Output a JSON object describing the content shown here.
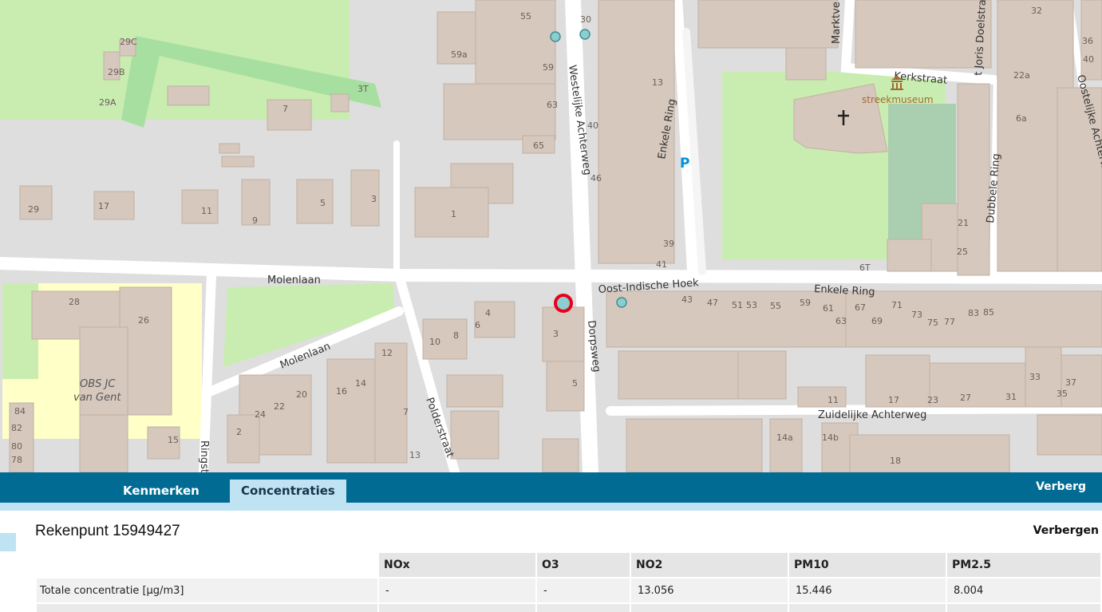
{
  "map": {
    "streets": {
      "molenlaan": "Molenlaan",
      "westelijke_achterweg": "Westelijke Achterweg",
      "dorpsweg": "Dorpsweg",
      "oost_indische_hoek": "Oost-Indische Hoek",
      "enkele_ring_vertical": "Enkele Ring",
      "enkele_ring": "Enkele Ring",
      "zuidelijke_achterweg": "Zuidelijke Achterweg",
      "polderstraat": "Polderstraat",
      "kerkstraat": "Kerkstraat",
      "dubbele_ring": "Dubbele Ring",
      "oostelijke_achterweg": "Oostelijke Achterweg",
      "sint_joris_doelstraat": "t Joris Doelstraat",
      "marktveld": "Marktve",
      "ringstraat": "Ringst"
    },
    "poi": {
      "museum": "streekmuseum",
      "school_line1": "OBS JC",
      "school_line2": "van Gent",
      "parking": "P"
    },
    "colors": {
      "building": "#d6c8bd",
      "park": "#c9edb0",
      "cemetery": "#aacfb0",
      "meadow": "#a7dfa0",
      "road": "#ffffff",
      "school_area": "#ffffc8",
      "marker": "#e8001c"
    },
    "house_numbers": {
      "n55": "55",
      "n59a": "59a",
      "n59": "59",
      "n63": "63",
      "n65": "65",
      "n1a": "1",
      "n30": "30",
      "n40": "40",
      "n46": "46",
      "n29c": "29C",
      "n29b": "29B",
      "n29a": "29A",
      "n7": "7",
      "n3t": "3T",
      "n29": "29",
      "n17": "17",
      "n11": "11",
      "n9": "9",
      "n5": "5",
      "n3": "3",
      "n28": "28",
      "n26": "26",
      "n84": "84",
      "n82": "82",
      "n80": "80",
      "n78": "78",
      "n15": "15",
      "n4": "4",
      "n6": "6",
      "n10": "10",
      "n8": "8",
      "n3b": "3",
      "n5b": "5",
      "n12": "12",
      "n16": "16",
      "n14": "14",
      "n20": "20",
      "n22": "22",
      "n24": "24",
      "n2": "2",
      "n7b": "7",
      "n13": "13",
      "n43": "43",
      "n47": "47",
      "n51": "51",
      "n53": "53",
      "n55b": "55",
      "n59b": "59",
      "n61": "61",
      "n63b": "63",
      "n67": "67",
      "n69": "69",
      "n71": "71",
      "n73": "73",
      "n75": "75",
      "n77": "77",
      "n83": "83",
      "n85": "85",
      "n33": "33",
      "n37": "37",
      "n35": "35",
      "n23": "23",
      "n27": "27",
      "n31": "31",
      "n17b": "17",
      "n11b": "11",
      "n14a": "14a",
      "n14b": "14b",
      "n18": "18",
      "n6t": "6T",
      "n25": "25",
      "n21": "21",
      "n41": "41",
      "n39": "39",
      "n13b": "13",
      "n32": "32",
      "n36": "36",
      "n40b": "40",
      "n22a": "22a",
      "n6a": "6a"
    }
  },
  "tabs": {
    "kenmerken": "Kenmerken",
    "concentraties": "Concentraties",
    "verberg": "Verberg"
  },
  "panel": {
    "title": "Rekenpunt 15949427",
    "hide_label": "Verbergen",
    "table": {
      "headers": [
        "NOx",
        "O3",
        "NO2",
        "PM10",
        "PM2.5"
      ],
      "rows": [
        {
          "label": "Totale concentratie [µg/m3]",
          "values": [
            "-",
            "-",
            "13.056",
            "15.446",
            "8.004"
          ]
        }
      ]
    }
  }
}
